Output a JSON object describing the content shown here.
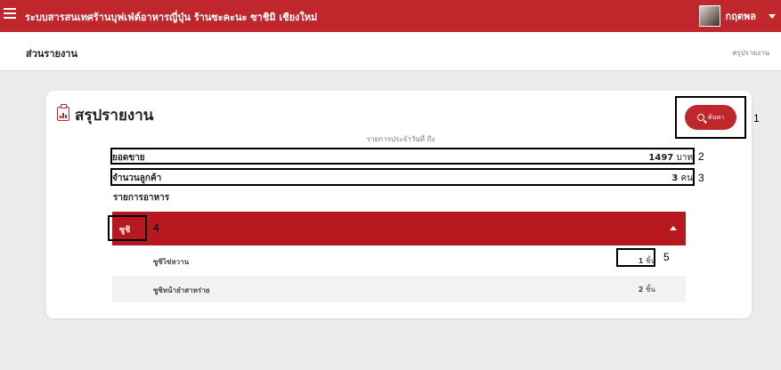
{
  "topbar": {
    "app_title": "ระบบสารสนเทศร้านบุฟเฟ่ต์อาหารญี่ปุ่น ร้านซะคะนะ ซาชิมิ เชียงใหม่",
    "user_name": "กฤตพล",
    "color": "#c0272d"
  },
  "subbar": {
    "title": "ส่วนรายงาน",
    "breadcrumb": "สรุปรายงาน"
  },
  "report": {
    "title": "สรุปรายงาน",
    "search_label": "ค้นหา",
    "date_caption": "รายการประจำวันที่ ถึง",
    "sales_label": "ยอดขาย",
    "sales_value": "1497",
    "sales_unit": "บาท",
    "customers_label": "จำนวนลูกค้า",
    "customers_value": "3",
    "customers_unit": "คน",
    "food_list_label": "รายการอาหาร"
  },
  "category": {
    "name": "ซูชิ",
    "color": "#b7181f",
    "items": [
      {
        "name": "ซูชิไข่หวาน",
        "qty": "1",
        "unit": "ชิ้น"
      },
      {
        "name": "ซูชิหน้ายำสาหร่าย",
        "qty": "2",
        "unit": "ชิ้น"
      }
    ]
  },
  "annotations": [
    "1",
    "2",
    "3",
    "4",
    "5"
  ]
}
